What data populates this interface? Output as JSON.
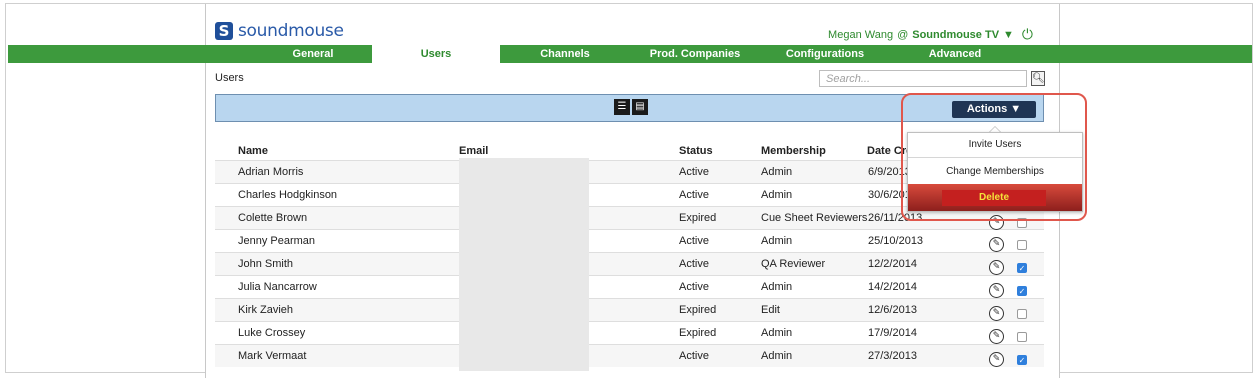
{
  "header": {
    "logo_text": "soundmouse",
    "user_name": "Megan Wang",
    "at": "@",
    "tenant": "Soundmouse TV",
    "tenant_caret": "▼"
  },
  "nav": {
    "tabs": [
      {
        "label": "General"
      },
      {
        "label": "Users"
      },
      {
        "label": "Channels"
      },
      {
        "label": "Prod. Companies"
      },
      {
        "label": "Configurations"
      },
      {
        "label": "Advanced"
      }
    ],
    "active": "Users"
  },
  "page": {
    "title": "Users",
    "search_placeholder": "Search..."
  },
  "toolbar": {
    "actions_label": "Actions ▼"
  },
  "actions_menu": {
    "items": [
      "Invite Users",
      "Change Memberships"
    ],
    "delete_label": "Delete"
  },
  "table": {
    "columns": [
      "Name",
      "Email",
      "Status",
      "Membership",
      "Date Cre"
    ],
    "rows": [
      {
        "name": "Adrian Morris",
        "status": "Active",
        "membership": "Admin",
        "date": "6/9/2013",
        "checked": false
      },
      {
        "name": "Charles Hodgkinson",
        "status": "Active",
        "membership": "Admin",
        "date": "30/6/201",
        "checked": false
      },
      {
        "name": "Colette Brown",
        "status": "Expired",
        "membership": "Cue Sheet Reviewers",
        "date": "26/11/2013",
        "checked": false
      },
      {
        "name": "Jenny Pearman",
        "status": "Active",
        "membership": "Admin",
        "date": "25/10/2013",
        "checked": false
      },
      {
        "name": "John Smith",
        "status": "Active",
        "membership": "QA Reviewer",
        "date": "12/2/2014",
        "checked": true
      },
      {
        "name": "Julia Nancarrow",
        "status": "Active",
        "membership": "Admin",
        "date": "14/2/2014",
        "checked": true
      },
      {
        "name": "Kirk Zavieh",
        "status": "Expired",
        "membership": "Edit",
        "date": "12/6/2013",
        "checked": false
      },
      {
        "name": "Luke Crossey",
        "status": "Expired",
        "membership": "Admin",
        "date": "17/9/2014",
        "checked": false
      },
      {
        "name": "Mark Vermaat",
        "status": "Active",
        "membership": "Admin",
        "date": "27/3/2013",
        "checked": true
      }
    ]
  },
  "colors": {
    "nav_green": "#3d9a3d",
    "toolbar_blue": "#b9d6ef",
    "actions_navy": "#1f3554",
    "delete_red": "#c4201f",
    "highlight_ring": "#e0574c"
  }
}
